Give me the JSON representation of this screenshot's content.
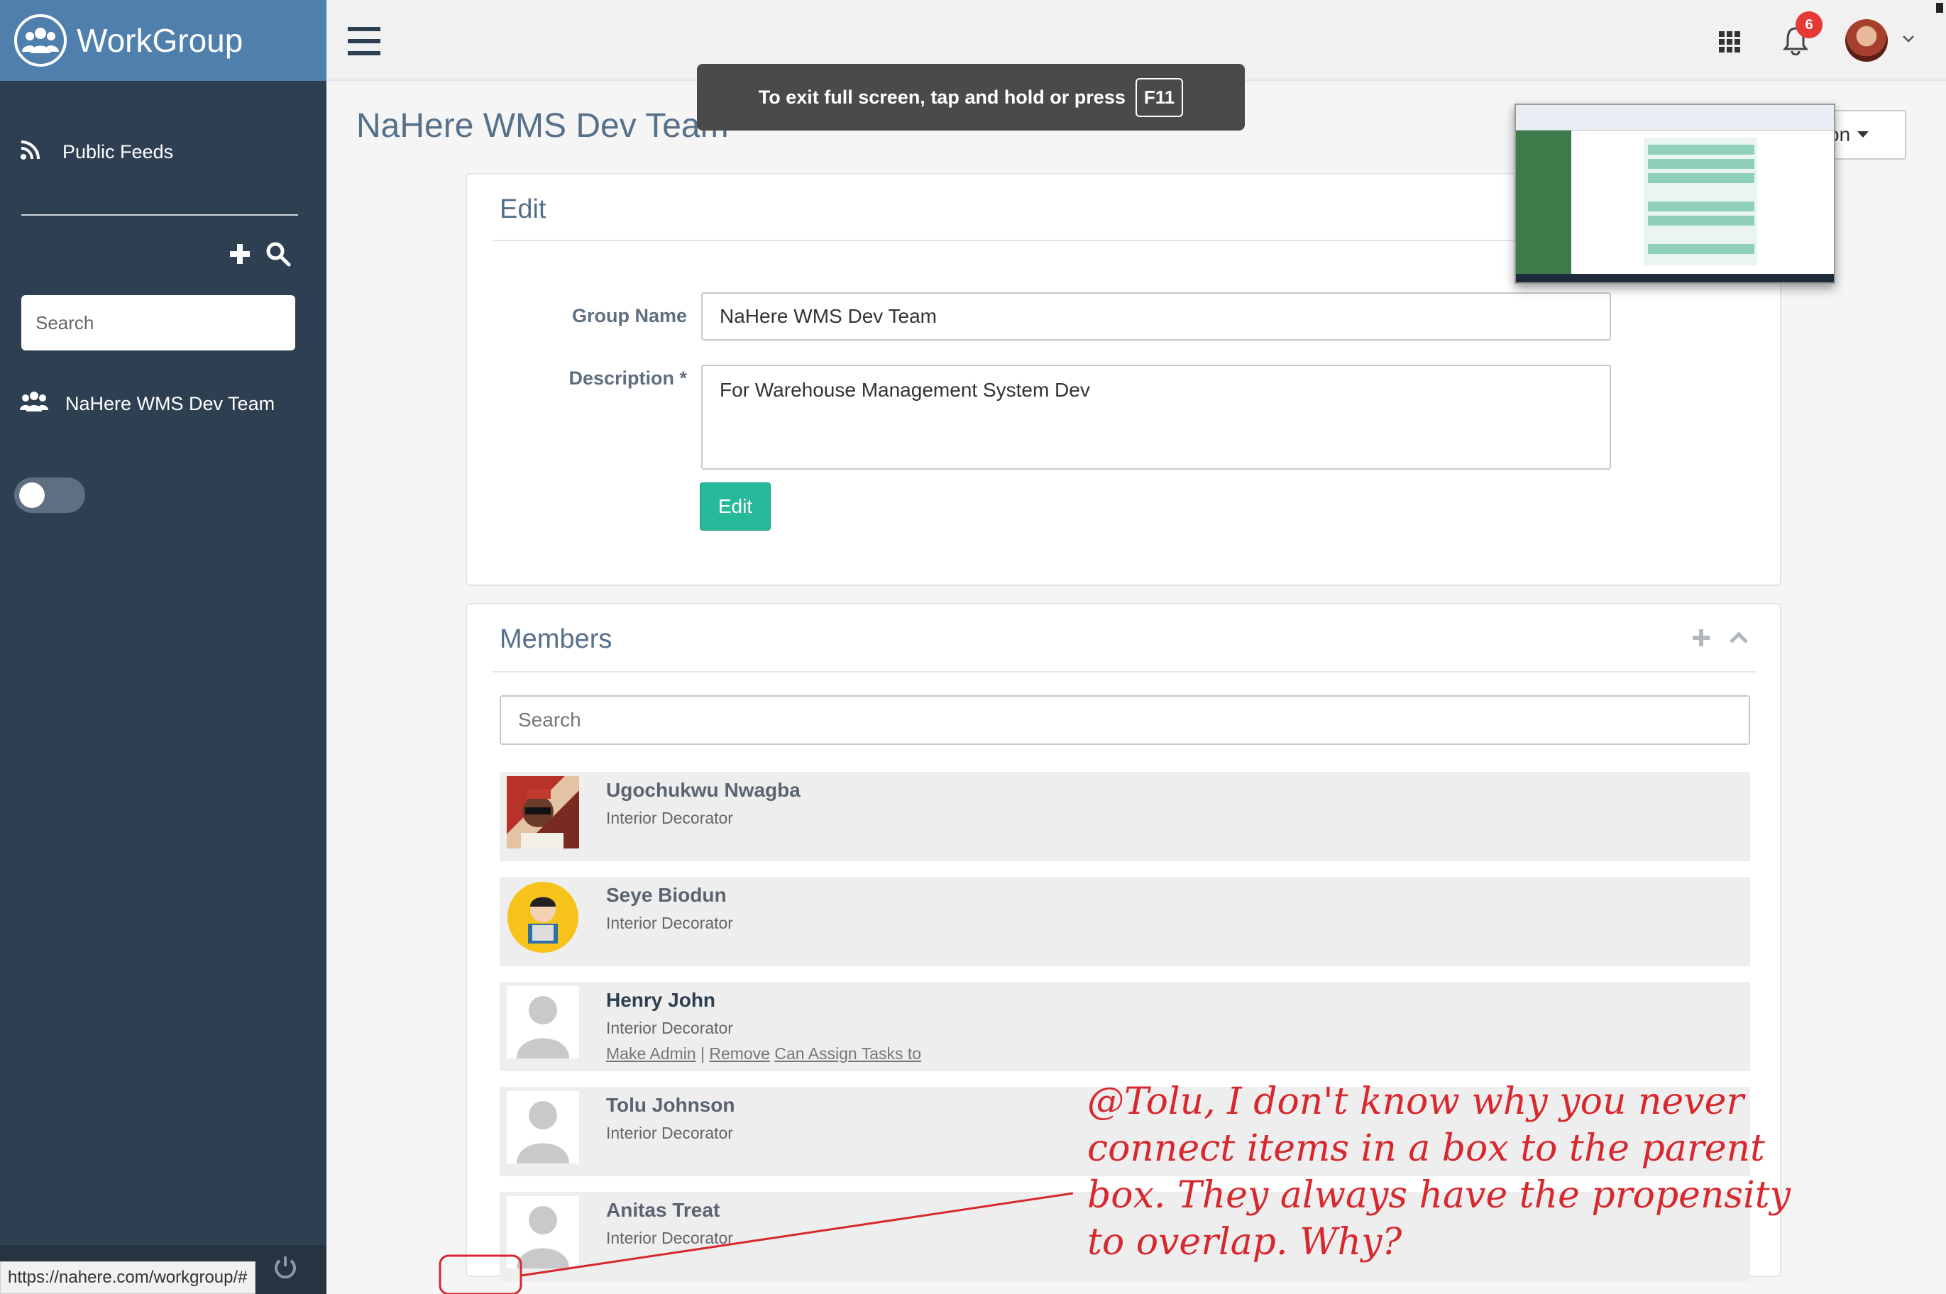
{
  "app": {
    "name": "WorkGroup"
  },
  "sidebar": {
    "public_feeds": "Public Feeds",
    "search_placeholder": "Search",
    "group": "NaHere WMS Dev Team"
  },
  "page": {
    "title": "NaHere WMS Dev Team",
    "action_label": "tion"
  },
  "toast": {
    "text": "To exit full screen, tap and hold or press",
    "key": "F11"
  },
  "notifications": {
    "count": "6"
  },
  "edit_card": {
    "title": "Edit",
    "group_name_label": "Group Name",
    "group_name_value": "NaHere WMS Dev Team",
    "description_label": "Description *",
    "description_value": "For Warehouse Management System Dev",
    "edit_button": "Edit"
  },
  "members_card": {
    "title": "Members",
    "search_placeholder": "Search",
    "members": [
      {
        "name": "Ugochukwu Nwagba",
        "role": "Interior Decorator"
      },
      {
        "name": "Seye Biodun",
        "role": "Interior Decorator"
      },
      {
        "name": "Henry John",
        "role": "Interior Decorator",
        "make_admin": "Make Admin",
        "sep": "|",
        "remove": "Remove",
        "assign": "Can Assign Tasks to"
      },
      {
        "name": "Tolu Johnson",
        "role": "Interior Decorator"
      },
      {
        "name": "Anitas Treat",
        "role": "Interior Decorator"
      }
    ]
  },
  "annotation": {
    "line1": "@Tolu, I don't know why you never",
    "line2": "connect items in a box to the parent",
    "line3": "box. They always have the propensity",
    "line4": "to overlap. Why?"
  },
  "status_bar": {
    "url": "https://nahere.com/workgroup/#"
  },
  "colors": {
    "sidebar": "#2e3f52",
    "brand": "#4f7fac",
    "accent": "#26b99a",
    "annotation": "#d6282e"
  }
}
